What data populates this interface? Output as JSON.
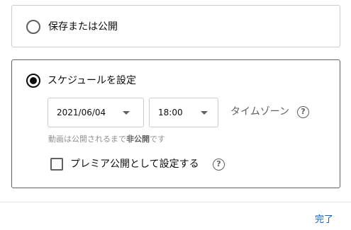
{
  "visibility": {
    "save_or_publish": {
      "label": "保存または公開",
      "selected": false
    },
    "schedule": {
      "label": "スケジュールを設定",
      "selected": true,
      "date": "2021/06/04",
      "time": "18:00",
      "timezone_label": "タイムゾーン",
      "note_prefix": "動画は公開されるまで",
      "note_bold": "非公開",
      "note_suffix": "です",
      "premiere_label": "プレミア公開として設定する",
      "premiere_checked": false
    }
  },
  "icons": {
    "help": "help-circle-icon",
    "dropdown": "arrow-drop-down-icon"
  },
  "help_glyph": "?",
  "footer": {
    "done_label": "完了"
  },
  "colors": {
    "accent": "#065fd4",
    "text": "#0d0d0d",
    "secondary": "#606060"
  }
}
